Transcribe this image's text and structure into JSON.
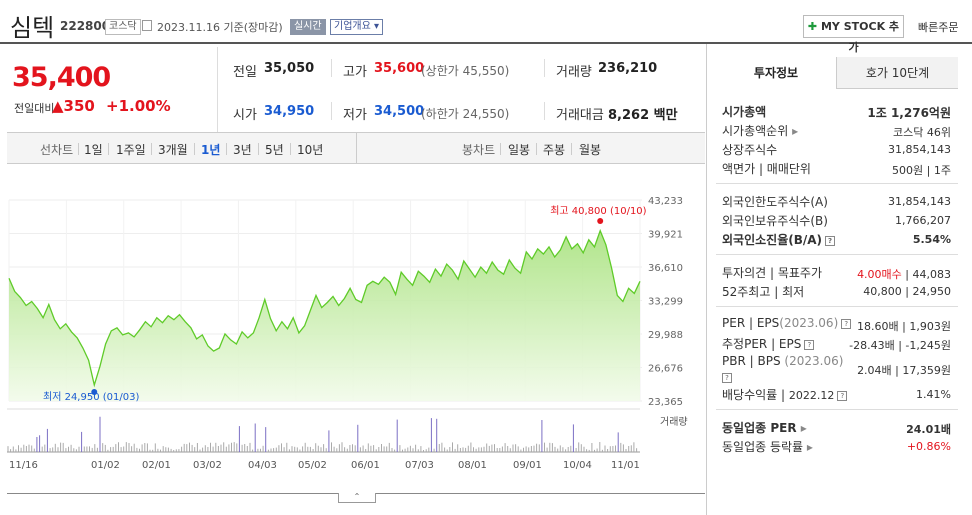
{
  "header": {
    "name": "심텍",
    "code": "222800",
    "market": "코스닥",
    "date": "2023.11.16",
    "date_note": "기준(장마감)",
    "realtime": "실시간",
    "corp_info": "기업개요",
    "mystock": "MY STOCK 추가",
    "quick_order": "빠른주문"
  },
  "price": {
    "current": "35,400",
    "prev_label": "전일대비",
    "change": "350",
    "change_pct": "+1.00%"
  },
  "summary": {
    "prev_close_label": "전일",
    "prev_close": "35,050",
    "high_label": "고가",
    "high": "35,600",
    "upper_limit": "(상한가 45,550)",
    "volume_label": "거래량",
    "volume": "236,210",
    "open_label": "시가",
    "open": "34,950",
    "low_label": "저가",
    "low": "34,500",
    "lower_limit": "(하한가 24,550)",
    "amount_label": "거래대금",
    "amount": "8,262",
    "amount_unit": "백만"
  },
  "tabs": {
    "line_label": "선차트",
    "line_periods": [
      "1일",
      "1주일",
      "3개월",
      "1년",
      "3년",
      "5년",
      "10년"
    ],
    "selected": "1년",
    "candle_label": "봉차트",
    "candle_periods": [
      "일봉",
      "주봉",
      "월봉"
    ]
  },
  "chart_data": {
    "type": "area",
    "y_ticks": [
      "43,233",
      "39,921",
      "36,610",
      "33,299",
      "29,988",
      "26,676",
      "23,365"
    ],
    "ylim": [
      23365,
      43233
    ],
    "x_ticks": [
      "11/16",
      "01/02",
      "02/01",
      "03/02",
      "04/03",
      "05/02",
      "06/01",
      "07/03",
      "08/01",
      "09/01",
      "10/04",
      "11/01"
    ],
    "max_label": "최고 40,800 (10/10)",
    "min_label": "최저 24,950 (01/03)",
    "volume_label": "거래량",
    "color": "#5fcb29",
    "fill_color": "#c8f0b0",
    "values": [
      35500,
      34200,
      33600,
      32800,
      33200,
      32500,
      31600,
      32900,
      31400,
      30500,
      31000,
      30200,
      29600,
      28600,
      27400,
      24950,
      26800,
      29000,
      30300,
      30600,
      29900,
      30100,
      29700,
      30400,
      31200,
      30700,
      31600,
      31100,
      31800,
      31400,
      31900,
      31200,
      30600,
      29500,
      29900,
      28800,
      28300,
      28600,
      30000,
      29400,
      29000,
      30200,
      29600,
      30100,
      31600,
      33400,
      31500,
      30300,
      31200,
      30500,
      31600,
      30100,
      30800,
      32300,
      33800,
      32600,
      33100,
      33700,
      32800,
      33500,
      34500,
      33400,
      33100,
      34800,
      35200,
      34900,
      35600,
      35100,
      33900,
      36100,
      35400,
      34800,
      36200,
      35700,
      35100,
      36400,
      35700,
      36900,
      36300,
      35400,
      37200,
      36400,
      35600,
      36600,
      36000,
      37100,
      36300,
      35900,
      37300,
      36500,
      36000,
      38100,
      37400,
      38400,
      37900,
      38600,
      37600,
      38300,
      39600,
      38400,
      38900,
      38000,
      39300,
      38600,
      40200,
      38800,
      36500,
      33800,
      33200,
      34500,
      34000,
      35200
    ]
  },
  "invest": {
    "tab1": "투자정보",
    "tab2": "호가 10단계",
    "market_cap_label": "시가총액",
    "market_cap": "1조 1,276억원",
    "rank_label": "시가총액순위",
    "rank": "코스닥 46위",
    "shares_label": "상장주식수",
    "shares": "31,854,143",
    "par_label": "액면가",
    "trade_unit_label": "매매단위",
    "par": "500원",
    "trade_unit": "1주",
    "foreign_limit_label": "외국인한도주식수(A)",
    "foreign_limit": "31,854,143",
    "foreign_hold_label": "외국인보유주식수(B)",
    "foreign_hold": "1,766,207",
    "foreign_ratio_label": "외국인소진율(B/A)",
    "foreign_ratio": "5.54%",
    "opinion_label": "투자의견",
    "target_label": "목표주가",
    "opinion": "4.00매수",
    "target": "44,083",
    "w52_label": "52주최고",
    "w52_low_label": "최저",
    "w52_high": "40,800",
    "w52_low": "24,950",
    "per_label": "PER",
    "eps_label": "EPS",
    "per_year": "(2023.06)",
    "per": "18.60배",
    "eps": "1,903원",
    "est_per_label": "추정PER",
    "est_eps_label": "EPS",
    "est_per": "-28.43배",
    "est_eps": "-1,245원",
    "pbr_label": "PBR",
    "bps_label": "BPS",
    "pbr_year": "(2023.06)",
    "pbr": "2.04배",
    "bps": "17,359원",
    "div_label": "배당수익률",
    "div_year": "2022.12",
    "div": "1.41%",
    "sector_per_label": "동일업종 PER",
    "sector_per": "24.01배",
    "sector_chg_label": "동일업종 등락률",
    "sector_chg": "+0.86%"
  }
}
